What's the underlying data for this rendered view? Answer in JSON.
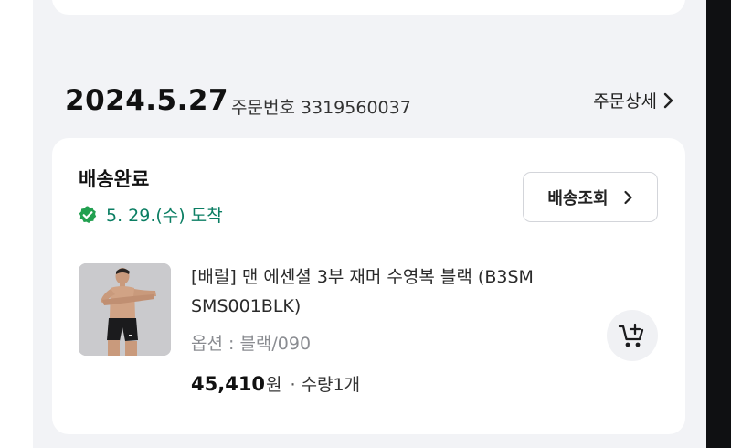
{
  "order": {
    "date": "2024.5.27",
    "number_label": "주문번호",
    "number": "3319560037",
    "detail_link": "주문상세"
  },
  "shipment": {
    "status": "배송완료",
    "arrival": "5. 29.(수) 도착",
    "track_button": "배송조회"
  },
  "product": {
    "name": "[배럴] 맨 에센셜 3부 재머 수영복 블랙 (B3SM SMS001BLK)",
    "option": "옵션 : 블랙/090",
    "price": "45,410",
    "currency": "원",
    "separator": "·",
    "quantity": "수량1개"
  },
  "icons": {
    "chevron": "chevron-right-icon",
    "check": "verified-check-icon",
    "cart": "add-to-cart-icon"
  },
  "colors": {
    "accent_green": "#0b7e63",
    "check_green": "#22a050",
    "card_bg": "#ffffff",
    "page_bg": "#f2f3f6"
  }
}
